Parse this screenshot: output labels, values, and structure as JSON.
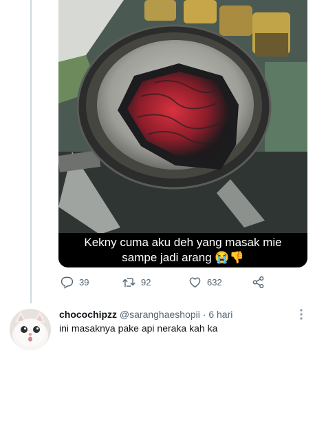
{
  "tweet": {
    "caption_line1": "Kekny cuma aku deh yang masak mie",
    "caption_line2": "sampe jadi arang",
    "caption_emojis": "😭👎",
    "reply_count": "39",
    "retweet_count": "92",
    "like_count": "632"
  },
  "reply": {
    "display_name": "chocochipzz",
    "handle": "@saranghaeshopii",
    "separator": "·",
    "time": "6 hari",
    "text": "ini masaknya pake api neraka kah ka"
  },
  "icons": {
    "reply": "reply-icon",
    "retweet": "retweet-icon",
    "like": "heart-icon",
    "share": "share-icon",
    "more": "more-icon"
  },
  "colors": {
    "icon_gray": "#536471",
    "thread_line": "#cfd9de",
    "caption_bg": "#000000"
  }
}
